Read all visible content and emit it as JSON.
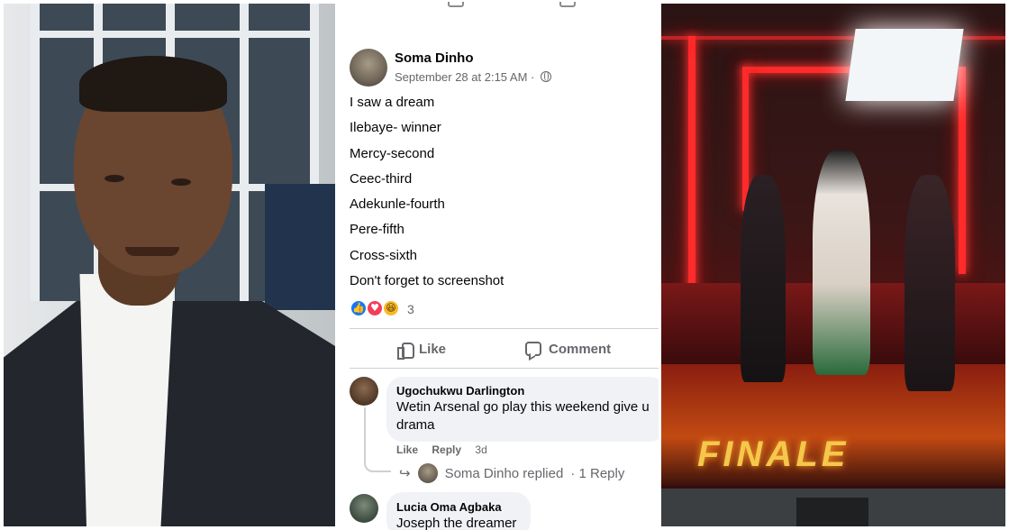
{
  "post": {
    "author": "Soma Dinho",
    "meta": "September 28 at 2:15 AM ·",
    "lines": [
      "I saw a dream",
      "Ilebaye- winner",
      "Mercy-second",
      "Ceec-third",
      "Adekunle-fourth",
      "Pere-fifth",
      "Cross-sixth",
      "Don't forget to screenshot"
    ],
    "reaction_count": "3",
    "reactions": [
      "like",
      "love",
      "haha"
    ],
    "like_label": "Like",
    "comment_label": "Comment"
  },
  "comments": [
    {
      "author": "Ugochukwu Darlington",
      "text": "Wetin Arsenal go play this weekend give u drama",
      "like": "Like",
      "reply": "Reply",
      "age": "3d",
      "replied_by": "Soma Dinho replied",
      "replies": "· 1 Reply"
    },
    {
      "author": "Lucia Oma Agbaka",
      "text": "Joseph the dreamer"
    }
  ],
  "stage": {
    "logo_text": "FINALE"
  },
  "colors": {
    "fb_text": "#050505",
    "fb_secondary": "#65676b",
    "like_blue": "#1877f2",
    "love_red": "#f33e58",
    "haha_yellow": "#f7b928",
    "neon_red": "#ff2a2a"
  }
}
